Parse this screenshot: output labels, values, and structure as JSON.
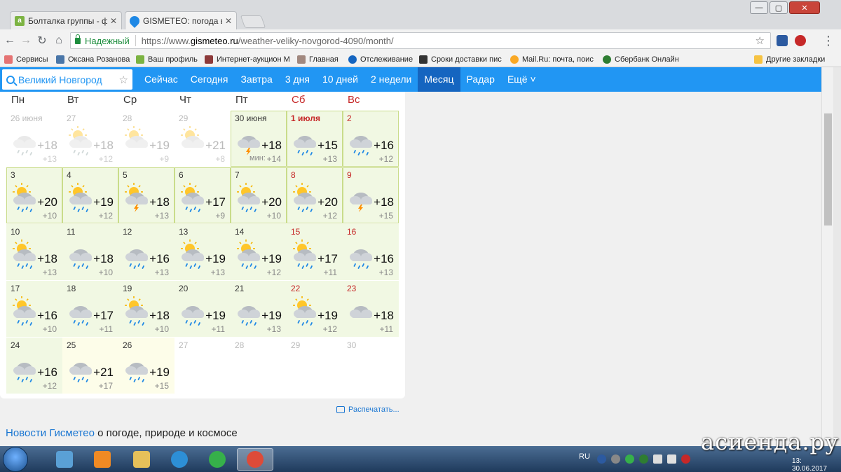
{
  "browser": {
    "tabs": [
      {
        "title": "Болталка группы - фор",
        "icon_color": "#7cb342",
        "icon_letter": "a"
      },
      {
        "title": "GISMETEO: погода в Ве",
        "icon_color": "#1e88e5",
        "icon_letter": ""
      }
    ],
    "win_controls": [
      "—",
      "▢",
      "✕"
    ],
    "secure_label": "Надежный",
    "url_proto": "https://www.",
    "url_host": "gismeteo.ru",
    "url_path": "/weather-veliky-novgorod-4090/month/",
    "bookmarks": [
      {
        "label": "Сервисы",
        "color": "#e57373"
      },
      {
        "label": "Оксана Розанова",
        "color": "#4a76a8"
      },
      {
        "label": "Ваш профиль",
        "color": "#7cb342"
      },
      {
        "label": "Интернет-аукцион М",
        "color": "#8d3a3a"
      },
      {
        "label": "Главная",
        "color": "#a1887f"
      },
      {
        "label": "Отслеживание",
        "color": "#1565c0"
      },
      {
        "label": "Сроки доставки пис",
        "color": "#333333"
      },
      {
        "label": "Mail.Ru: почта, поис",
        "color": "#f9a825"
      },
      {
        "label": "Сбербанк Онлайн",
        "color": "#2e7d32"
      },
      {
        "label": "Другие закладки",
        "color": "#f6c343"
      }
    ]
  },
  "site": {
    "city": "Великий Новгород",
    "nav": [
      "Сейчас",
      "Сегодня",
      "Завтра",
      "3 дня",
      "10 дней",
      "2 недели",
      "Месяц",
      "Радар",
      "Ещё ˅"
    ],
    "active_nav": "Месяц",
    "weekdays": [
      "Пн",
      "Вт",
      "Ср",
      "Чт",
      "Пт",
      "Сб",
      "Вс"
    ],
    "min_label": "мин:",
    "print_label": "Распечатать...",
    "news_link": "Новости Гисметео",
    "news_rest": " о погоде, природе и космосе"
  },
  "calendar": [
    [
      {
        "date": "26 июня",
        "max": "+18",
        "min": "+13",
        "icon": "cloud-rain",
        "past": true
      },
      {
        "date": "27",
        "max": "+18",
        "min": "+12",
        "icon": "sun-cloud-rain",
        "past": true
      },
      {
        "date": "28",
        "max": "+19",
        "min": "+9",
        "icon": "sun-cloud",
        "past": true
      },
      {
        "date": "29",
        "max": "+21",
        "min": "+8",
        "icon": "sun-cloud",
        "past": true
      },
      {
        "date": "30 июня",
        "max": "+18",
        "min": "+14",
        "icon": "cloud-storm",
        "min_label": true
      },
      {
        "date": "1 июля",
        "max": "+15",
        "min": "+13",
        "icon": "cloud-rain",
        "weekend": true,
        "bold": true
      },
      {
        "date": "2",
        "max": "+16",
        "min": "+12",
        "icon": "cloud-rain",
        "weekend": true
      }
    ],
    [
      {
        "date": "3",
        "max": "+20",
        "min": "+10",
        "icon": "sun-cloud-rain"
      },
      {
        "date": "4",
        "max": "+19",
        "min": "+12",
        "icon": "sun-cloud-rain"
      },
      {
        "date": "5",
        "max": "+18",
        "min": "+13",
        "icon": "sun-cloud-storm"
      },
      {
        "date": "6",
        "max": "+17",
        "min": "+9",
        "icon": "sun-cloud-rain"
      },
      {
        "date": "7",
        "max": "+20",
        "min": "+10",
        "icon": "sun-cloud-rain"
      },
      {
        "date": "8",
        "max": "+20",
        "min": "+12",
        "icon": "sun-cloud-rain",
        "weekend": true
      },
      {
        "date": "9",
        "max": "+18",
        "min": "+15",
        "icon": "cloud-storm",
        "weekend": true
      }
    ],
    [
      {
        "date": "10",
        "max": "+18",
        "min": "+13",
        "icon": "sun-cloud-rain"
      },
      {
        "date": "11",
        "max": "+18",
        "min": "+10",
        "icon": "cloud-rain"
      },
      {
        "date": "12",
        "max": "+16",
        "min": "+13",
        "icon": "cloud-rain"
      },
      {
        "date": "13",
        "max": "+19",
        "min": "+13",
        "icon": "sun-cloud-rain"
      },
      {
        "date": "14",
        "max": "+19",
        "min": "+12",
        "icon": "sun-cloud-rain"
      },
      {
        "date": "15",
        "max": "+17",
        "min": "+11",
        "icon": "sun-cloud-rain",
        "weekend": true
      },
      {
        "date": "16",
        "max": "+16",
        "min": "+13",
        "icon": "cloud-rain",
        "weekend": true
      }
    ],
    [
      {
        "date": "17",
        "max": "+16",
        "min": "+10",
        "icon": "sun-cloud-rain"
      },
      {
        "date": "18",
        "max": "+17",
        "min": "+11",
        "icon": "cloud-rain"
      },
      {
        "date": "19",
        "max": "+18",
        "min": "+10",
        "icon": "sun-cloud-rain"
      },
      {
        "date": "20",
        "max": "+19",
        "min": "+11",
        "icon": "cloud-rain"
      },
      {
        "date": "21",
        "max": "+19",
        "min": "+13",
        "icon": "cloud-rain"
      },
      {
        "date": "22",
        "max": "+19",
        "min": "+12",
        "icon": "sun-cloud-rain",
        "weekend": true
      },
      {
        "date": "23",
        "max": "+18",
        "min": "+11",
        "icon": "cloud",
        "weekend": true
      }
    ],
    [
      {
        "date": "24",
        "max": "+16",
        "min": "+12",
        "icon": "cloud-rain"
      },
      {
        "date": "25",
        "max": "+21",
        "min": "+17",
        "icon": "cloud-rain",
        "yellow": true
      },
      {
        "date": "26",
        "max": "+19",
        "min": "+15",
        "icon": "cloud-rain",
        "yellow": true
      },
      {
        "date": "27",
        "empty": true
      },
      {
        "date": "28",
        "empty": true
      },
      {
        "date": "29",
        "empty": true
      },
      {
        "date": "30",
        "empty": true
      }
    ]
  ],
  "taskbar": {
    "lang": "RU",
    "time": "13:",
    "date": "30.06.2017",
    "items": [
      {
        "name": "explorer-app",
        "color": "#5aa0d6"
      },
      {
        "name": "media-app",
        "color": "#f08a24"
      },
      {
        "name": "folder-app",
        "color": "#e6c15a"
      },
      {
        "name": "ie-app",
        "color": "#2d8fd6"
      },
      {
        "name": "mailru-agent-app",
        "color": "#36b04a"
      },
      {
        "name": "chrome-app",
        "color": "#dd4b39"
      }
    ]
  },
  "watermark": "асиенда.ру",
  "colors": {
    "brand": "#2196f3",
    "brand_active": "#1565c0",
    "weekend": "#c62828",
    "cell_green": "#f1f8e3",
    "cell_yellow": "#fdfde9"
  }
}
